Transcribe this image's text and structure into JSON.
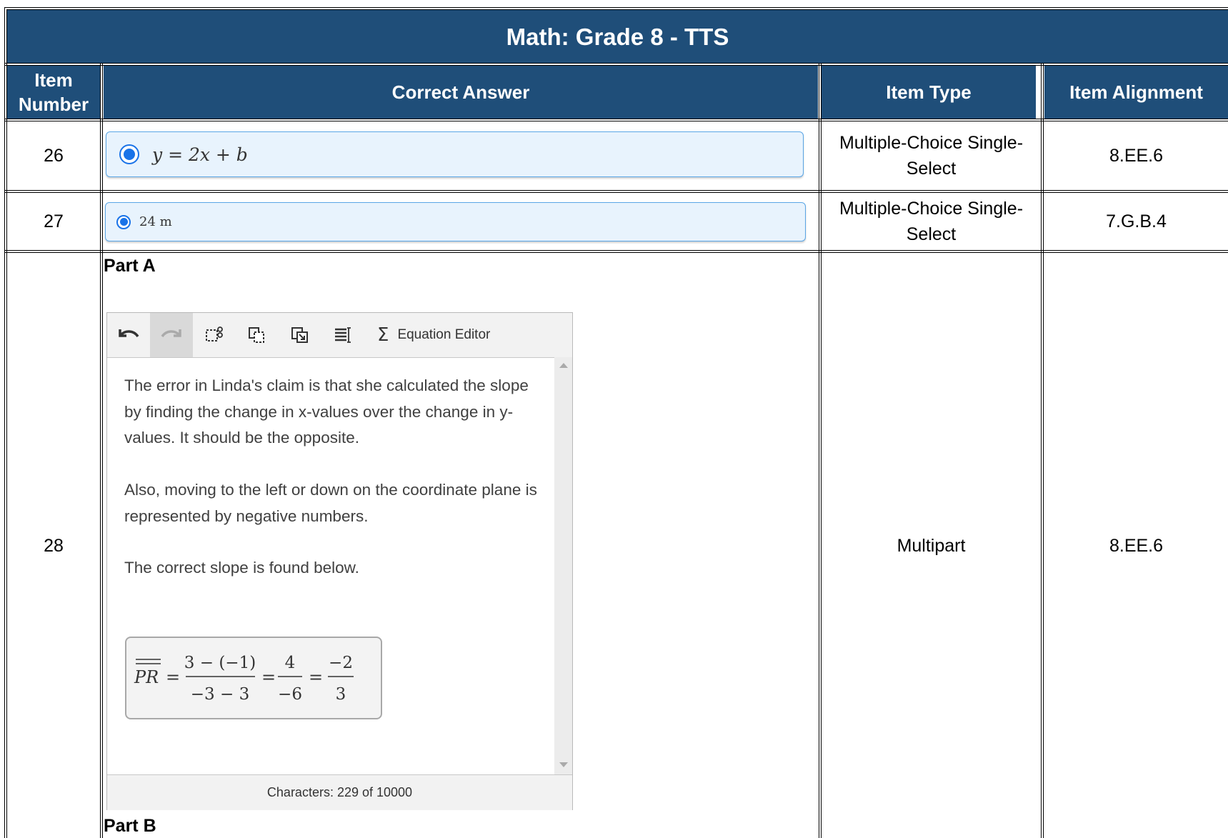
{
  "title": "Math: Grade 8 - TTS",
  "columns": {
    "item_number": "Item Number",
    "correct_answer": "Correct Answer",
    "item_type": "Item Type",
    "item_alignment": "Item Alignment"
  },
  "rows": [
    {
      "number": "26",
      "answer": "y = 2x + b",
      "type": "Multiple-Choice Single-Select",
      "alignment": "8.EE.6",
      "selected": true
    },
    {
      "number": "27",
      "answer": "24 m",
      "type": "Multiple-Choice Single-Select",
      "alignment": "7.G.B.4",
      "selected": true
    },
    {
      "number": "28",
      "type": "Multipart",
      "alignment": "8.EE.6"
    }
  ],
  "part_a": {
    "label": "Part A",
    "toolbar": {
      "icons": [
        "undo-icon",
        "redo-icon",
        "cut-icon",
        "copy-icon",
        "paste-icon",
        "special-characters-icon",
        "sigma-icon"
      ],
      "equation_editor_label": "Equation Editor"
    },
    "paragraphs": [
      "The error in Linda's claim is that she calculated the slope by finding the change in x-values over the change in y-values.  It should be the opposite.",
      "Also, moving to the left or down on the coordinate plane is represented by negative numbers.",
      "The correct slope is found below."
    ],
    "equation": {
      "lhs": "PR",
      "fraction1": {
        "numerator": "3 − (−1)",
        "denominator": "−3 − 3"
      },
      "fraction2": {
        "numerator": "4",
        "denominator": "−6"
      },
      "fraction3": {
        "numerator": "−2",
        "denominator": "3"
      }
    },
    "character_count": "Characters: 229 of 10000"
  },
  "part_b": {
    "label": "Part B"
  }
}
